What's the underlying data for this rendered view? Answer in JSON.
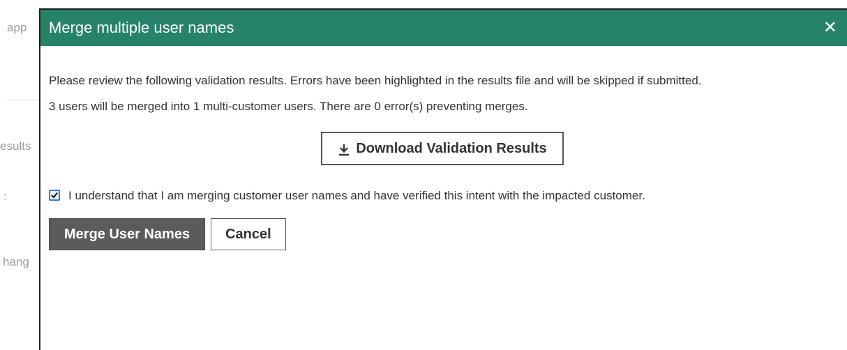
{
  "background": {
    "fragments": [
      "app",
      "esults",
      ":",
      "hang"
    ]
  },
  "dialog": {
    "title": "Merge multiple user names",
    "close_icon": "close-icon",
    "intro_text": "Please review the following validation results. Errors have been highlighted in the results file and will be skipped if submitted.",
    "summary_text": "3 users will be merged into 1 multi-customer users. There are 0 error(s) preventing merges.",
    "download_label": "Download Validation Results",
    "download_icon": "download-icon",
    "confirm_checked": true,
    "confirm_text": "I understand that I am merging customer user names and have verified this intent with the impacted customer.",
    "merge_label": "Merge User Names",
    "cancel_label": "Cancel"
  },
  "colors": {
    "header_bg": "#26836a",
    "primary_button": "#5b5b5b",
    "checkbox_border": "#3a77d8"
  }
}
